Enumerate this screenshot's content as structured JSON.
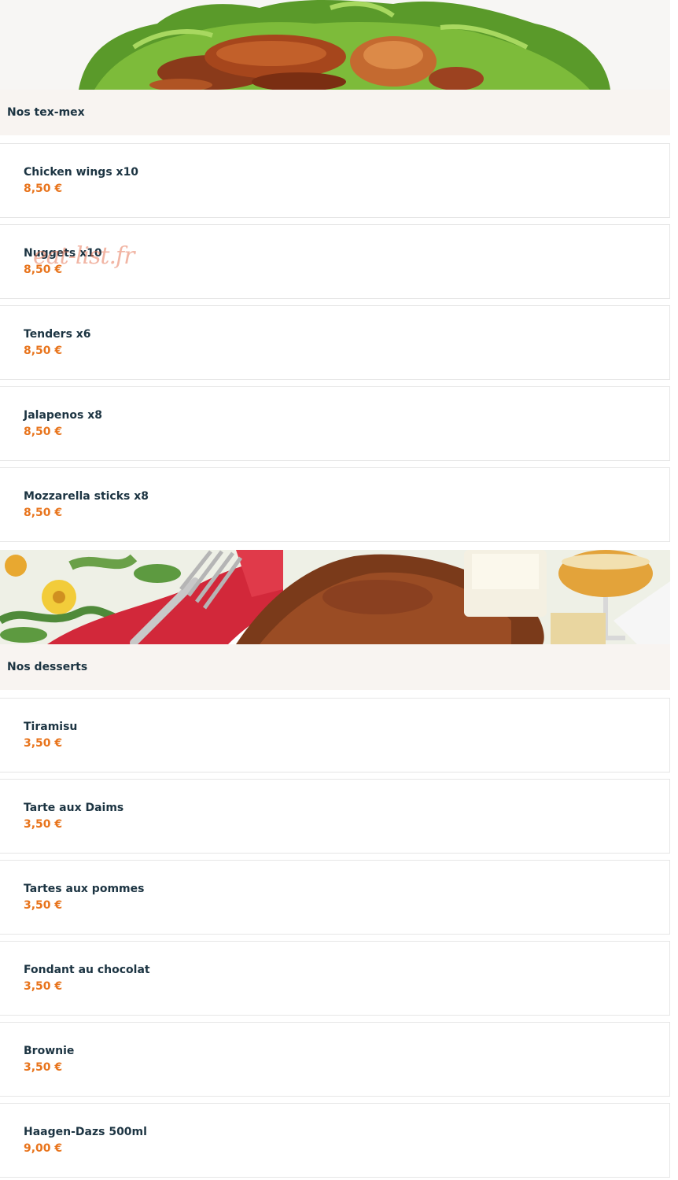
{
  "sections": [
    {
      "title": "Nos tex-mex",
      "banner_icon": "chicken-wings-image",
      "items": [
        {
          "name": "Chicken wings x10",
          "price": "8,50 €"
        },
        {
          "name": "Nuggets x10",
          "price": "8,50 €"
        },
        {
          "name": "Tenders x6",
          "price": "8,50 €"
        },
        {
          "name": "Jalapenos x8",
          "price": "8,50 €"
        },
        {
          "name": "Mozzarella sticks x8",
          "price": "8,50 €"
        }
      ]
    },
    {
      "title": "Nos desserts",
      "banner_icon": "tiramisu-image",
      "items": [
        {
          "name": "Tiramisu",
          "price": "3,50 €"
        },
        {
          "name": "Tarte aux Daims",
          "price": "3,50 €"
        },
        {
          "name": "Tartes aux pommes",
          "price": "3,50 €"
        },
        {
          "name": "Fondant au chocolat",
          "price": "3,50 €"
        },
        {
          "name": "Brownie",
          "price": "3,50 €"
        },
        {
          "name": "Haagen-Dazs 500ml",
          "price": "9,00 €"
        }
      ]
    }
  ],
  "watermark": "eat-list.fr",
  "colors": {
    "header_bg": "#f8f4f1",
    "text": "#1c3442",
    "price": "#e8741c"
  }
}
